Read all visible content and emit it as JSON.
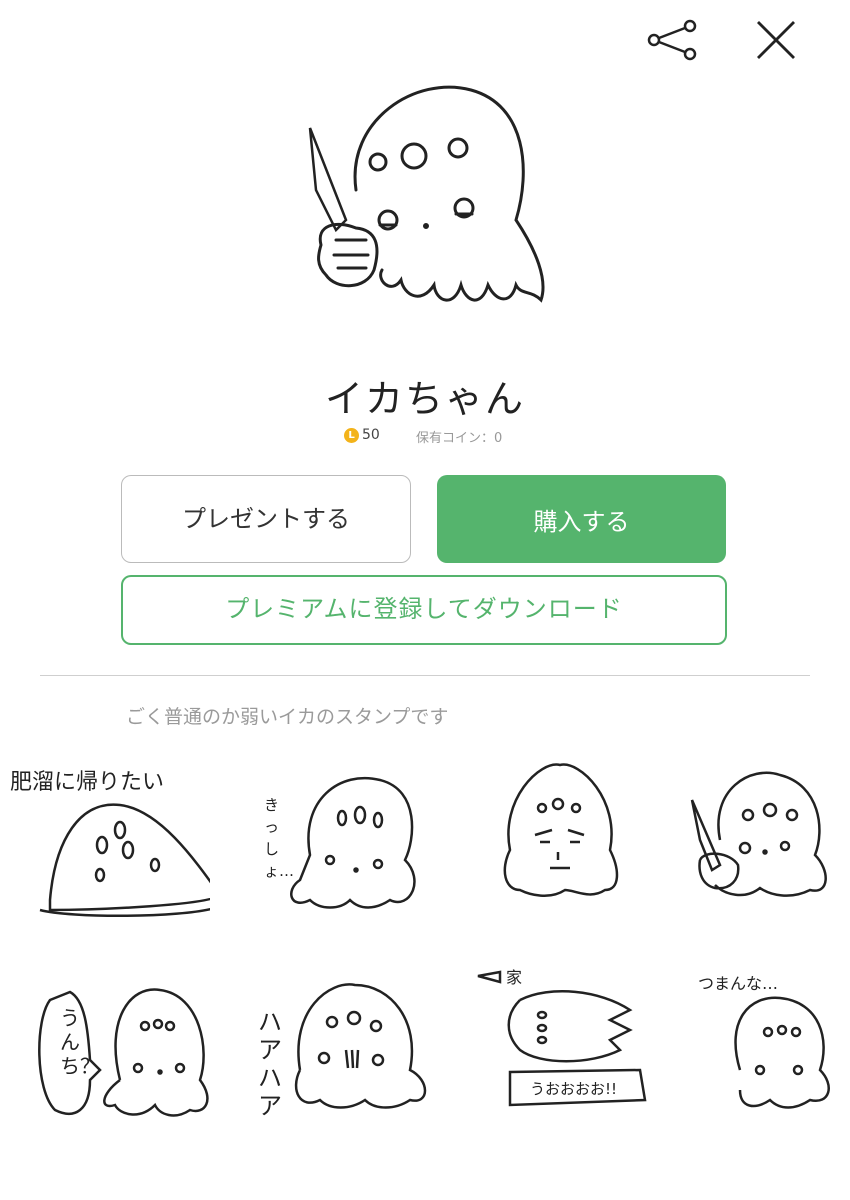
{
  "header": {
    "share_icon": "share-icon",
    "close_icon": "close-icon"
  },
  "product": {
    "title": "イカちゃん",
    "coin_icon_label": "L",
    "price": "50",
    "owned_coins": "保有コイン：0",
    "description": "ごく普通のか弱いイカのスタンプです"
  },
  "actions": {
    "present_label": "プレゼントする",
    "buy_label": "購入する",
    "premium_label": "プレミアムに登録してダウンロード"
  },
  "colors": {
    "accent": "#55b46d",
    "coin": "#f3b31a",
    "muted": "#999999"
  },
  "stickers": [
    {
      "caption": "肥溜に帰りたい"
    },
    {
      "caption": "きっしょ…"
    },
    {
      "caption": ""
    },
    {
      "caption": ""
    },
    {
      "caption": "うんち？"
    },
    {
      "caption": "ハア ハア"
    },
    {
      "caption": "家",
      "caption2": "うおおおお!!"
    },
    {
      "caption": "つまんな…"
    }
  ]
}
